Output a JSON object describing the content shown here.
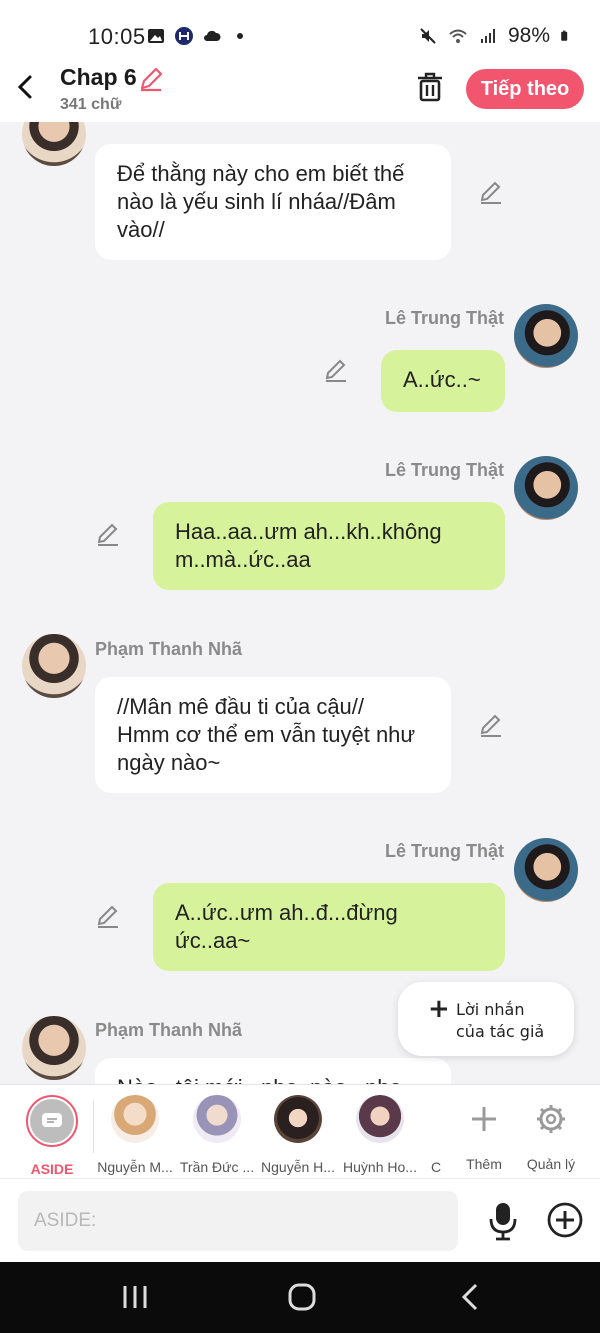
{
  "status_bar": {
    "time": "10:05",
    "battery": "98%",
    "icons": [
      "gallery-icon",
      "app-icon",
      "cloud-icon",
      "dot-icon",
      "mute-icon",
      "wifi-icon",
      "signal-icon",
      "battery-icon"
    ]
  },
  "header": {
    "title": "Chap 6",
    "word_count": "341 chữ",
    "next_label": "Tiếp theo"
  },
  "messages": [
    {
      "side": "left",
      "sender": "",
      "text_lines": [
        "Để thằng này cho em biết thế",
        "nào là yếu sinh lí nháa//Đâm",
        "vào//"
      ]
    },
    {
      "side": "right",
      "sender": "Lê Trung Thật",
      "text_lines": [
        "A..ức..~"
      ]
    },
    {
      "side": "right",
      "sender": "Lê Trung Thật",
      "text_lines": [
        "Haa..aa..ưm ah...kh..không",
        "m..mà..ức..aa"
      ]
    },
    {
      "side": "left",
      "sender": "Phạm Thanh Nhã",
      "text_lines": [
        "//Mân mê đầu ti của cậu//",
        "Hmm cơ thể em vẫn tuyệt như",
        "ngày nào~"
      ]
    },
    {
      "side": "right",
      "sender": "Lê Trung Thật",
      "text_lines": [
        "A..ức..ưm ah..đ...đừng",
        "ức..aa~"
      ]
    },
    {
      "side": "left",
      "sender": "Phạm Thanh Nhã",
      "text_lines": [
        "Nào...tôi mới...nhẹ..nào...nhẹ..."
      ]
    }
  ],
  "author_note": {
    "line1": "Lời nhắn",
    "line2": "của tác giả"
  },
  "characters": {
    "aside_label": "ASIDE",
    "items": [
      "Nguyễn M...",
      "Trần Đức ...",
      "Nguyễn H...",
      "Huỳnh Ho...",
      "C"
    ],
    "add_label": "Thêm",
    "manage_label": "Quản lý"
  },
  "input": {
    "placeholder": "ASIDE:"
  },
  "colors": {
    "accent": "#f2566e",
    "right_bubble": "#d6f29a",
    "left_bubble": "#ffffff",
    "background": "#f3f3f5"
  }
}
